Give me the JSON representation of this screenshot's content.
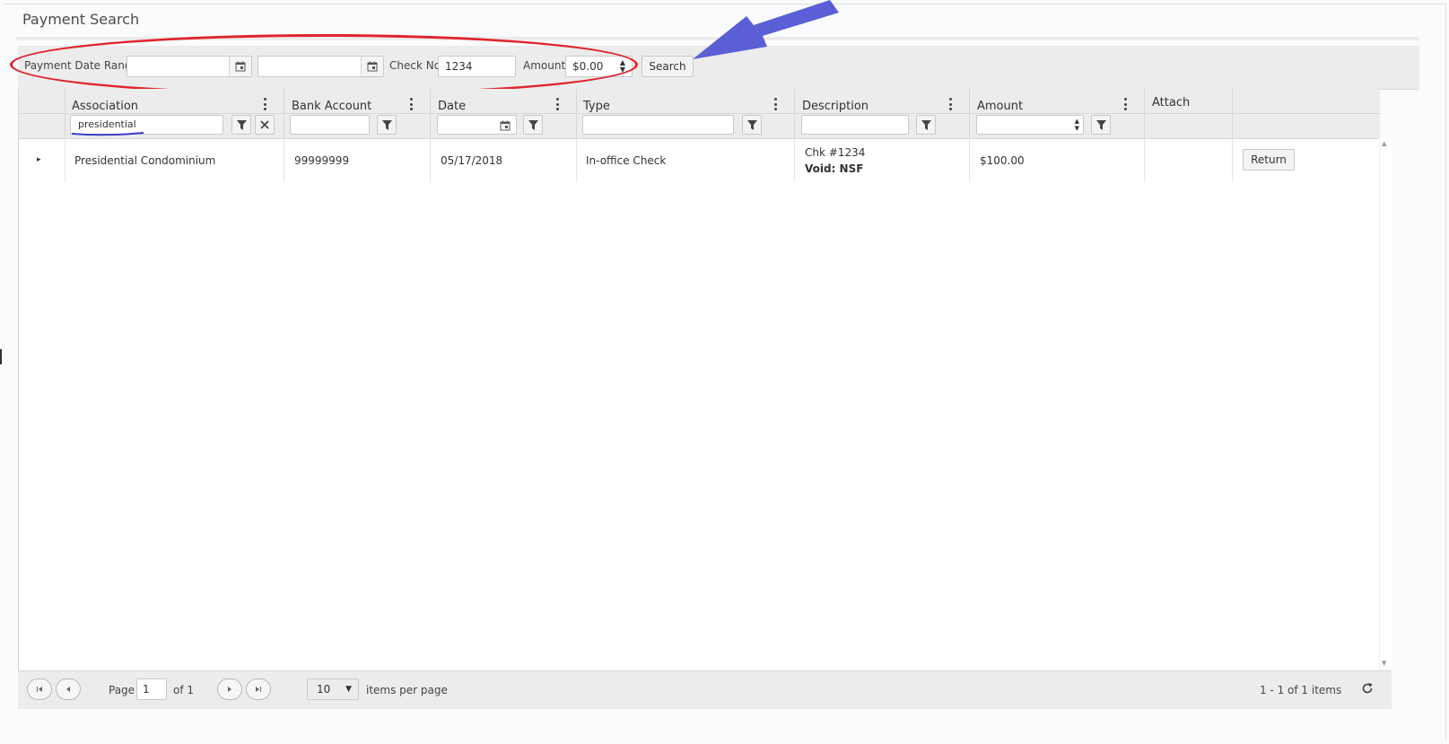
{
  "page": {
    "title": "Payment Search"
  },
  "filters": {
    "date_range_label": "Payment Date Range",
    "date_from": "",
    "date_to": "",
    "check_no_label": "Check No",
    "check_no_value": "1234",
    "amount_label": "Amount",
    "amount_value": "$0.00",
    "search_label": "Search"
  },
  "grid": {
    "columns": [
      {
        "title": "Association",
        "filter_value": "presidential"
      },
      {
        "title": "Bank Account",
        "filter_value": ""
      },
      {
        "title": "Date",
        "filter_value": ""
      },
      {
        "title": "Type",
        "filter_value": ""
      },
      {
        "title": "Description",
        "filter_value": ""
      },
      {
        "title": "Amount",
        "filter_value": ""
      },
      {
        "title": "Attach"
      }
    ],
    "rows": [
      {
        "association": "Presidential Condominium",
        "bank_account": "99999999",
        "date": "05/17/2018",
        "type": "In-office Check",
        "description_line1": "Chk #1234",
        "description_line2": "Void: NSF",
        "amount": "$100.00",
        "action_label": "Return"
      }
    ]
  },
  "pager": {
    "page_label": "Page",
    "page_value": "1",
    "of_label": "of 1",
    "page_size": "10",
    "items_per_page_label": "items per page",
    "summary": "1 - 1 of 1 items"
  },
  "annotations": {
    "ellipse_color": "#e0242c",
    "arrow_color": "#5b5fd6",
    "underline_color": "#3b3fc9"
  }
}
